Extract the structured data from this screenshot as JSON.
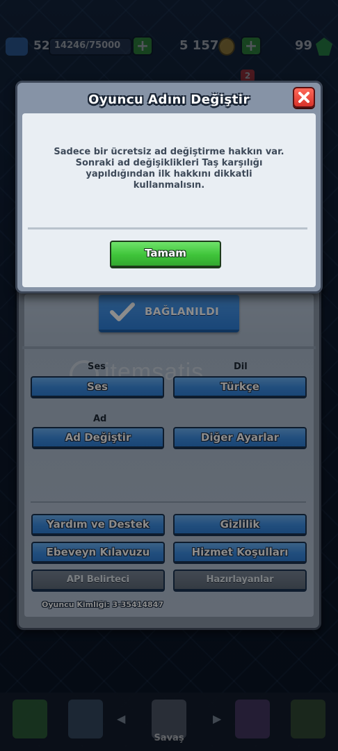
{
  "hud": {
    "level": "52",
    "xp": "14246/75000",
    "xp_plus": "+",
    "gold": "5 157",
    "gold_plus": "+",
    "gems": "99",
    "notification_count": "2"
  },
  "settings": {
    "connected_label": "BAĞLANILDI",
    "sound_section": "Ses",
    "language_section": "Dil",
    "sound_button": "Ses",
    "language_button": "Türkçe",
    "name_section": "Ad",
    "change_name_button": "Ad Değiştir",
    "other_settings_button": "Diğer Ayarlar",
    "help_button": "Yardım ve Destek",
    "privacy_button": "Gizlilik",
    "parent_guide_button": "Ebeveyn Kılavuzu",
    "terms_button": "Hizmet Koşulları",
    "api_button": "API Belirteci",
    "credits_button": "Hazırlayanlar",
    "player_id": "Oyuncu Kimliği: 3-35414847",
    "watermark": "itemsatis"
  },
  "dialog": {
    "title": "Oyuncu Adını Değiştir",
    "message": "Sadece bir ücretsiz ad değiştirme hakkın var. Sonraki ad değişiklikleri Taş karşılığı yapıldığından ilk hakkını dikkatli kullanmalısın.",
    "ok_button": "Tamam"
  },
  "bottom_nav": {
    "battle_label": "Savaş",
    "arrow_left": "◀",
    "arrow_right": "▶"
  },
  "colors": {
    "accent_blue": "#3d8ee4",
    "ok_green": "#3fc43a",
    "close_red": "#d8322a"
  }
}
